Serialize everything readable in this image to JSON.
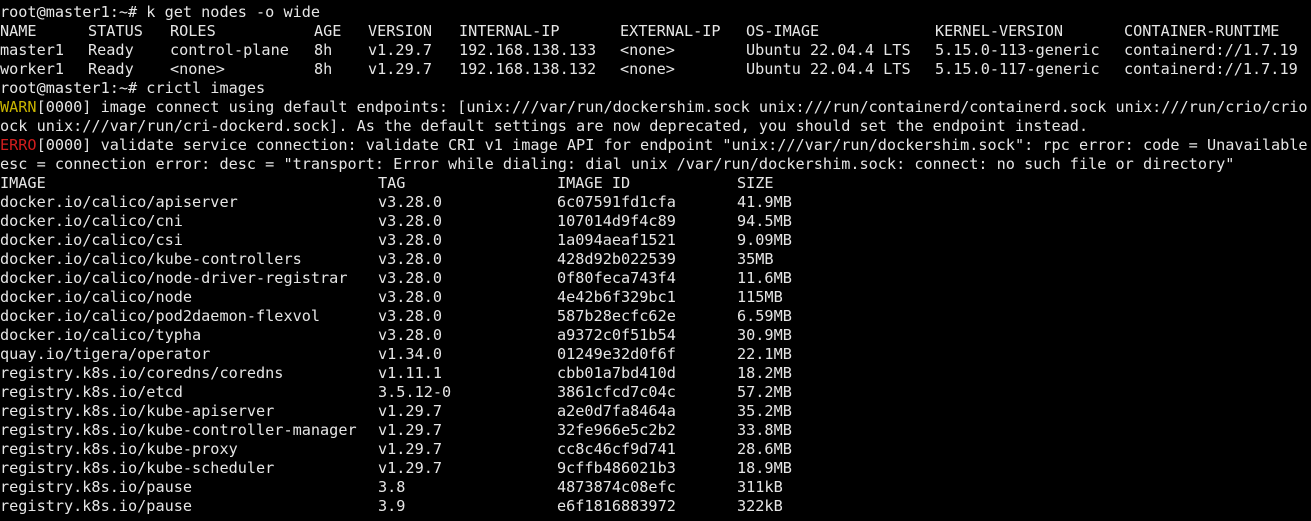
{
  "terminal": {
    "background": "#000000",
    "foreground": "#e6e6e6",
    "warn_color": "#c8b400",
    "error_color": "#d21e1e",
    "commands": {
      "get_nodes": "root@master1:~# k get nodes -o wide",
      "crictl_images": "root@master1:~# crictl images"
    },
    "nodes": {
      "headers": [
        "NAME",
        "STATUS",
        "ROLES",
        "AGE",
        "VERSION",
        "INTERNAL-IP",
        "EXTERNAL-IP",
        "OS-IMAGE",
        "KERNEL-VERSION",
        "CONTAINER-RUNTIME"
      ],
      "rows": [
        [
          "master1",
          "Ready",
          "control-plane",
          "8h",
          "v1.29.7",
          "192.168.138.133",
          "<none>",
          "Ubuntu 22.04.4 LTS",
          "5.15.0-113-generic",
          "containerd://1.7.19"
        ],
        [
          "worker1",
          "Ready",
          "<none>",
          "8h",
          "v1.29.7",
          "192.168.138.132",
          "<none>",
          "Ubuntu 22.04.4 LTS",
          "5.15.0-117-generic",
          "containerd://1.7.19"
        ]
      ]
    },
    "warn": {
      "tag": "WARN",
      "line1": "[0000] image connect using default endpoints: [unix:///var/run/dockershim.sock unix:///run/containerd/containerd.sock unix:///run/crio/crio.s",
      "line2": "ock unix:///var/run/cri-dockerd.sock]. As the default settings are now deprecated, you should set the endpoint instead."
    },
    "error": {
      "tag": "ERRO",
      "line1": "[0000] validate service connection: validate CRI v1 image API for endpoint \"unix:///var/run/dockershim.sock\": rpc error: code = Unavailable d",
      "line2": "esc = connection error: desc = \"transport: Error while dialing: dial unix /var/run/dockershim.sock: connect: no such file or directory\""
    },
    "images": {
      "headers": [
        "IMAGE",
        "TAG",
        "IMAGE ID",
        "SIZE"
      ],
      "rows": [
        [
          "docker.io/calico/apiserver",
          "v3.28.0",
          "6c07591fd1cfa",
          "41.9MB"
        ],
        [
          "docker.io/calico/cni",
          "v3.28.0",
          "107014d9f4c89",
          "94.5MB"
        ],
        [
          "docker.io/calico/csi",
          "v3.28.0",
          "1a094aeaf1521",
          "9.09MB"
        ],
        [
          "docker.io/calico/kube-controllers",
          "v3.28.0",
          "428d92b022539",
          "35MB"
        ],
        [
          "docker.io/calico/node-driver-registrar",
          "v3.28.0",
          "0f80feca743f4",
          "11.6MB"
        ],
        [
          "docker.io/calico/node",
          "v3.28.0",
          "4e42b6f329bc1",
          "115MB"
        ],
        [
          "docker.io/calico/pod2daemon-flexvol",
          "v3.28.0",
          "587b28ecfc62e",
          "6.59MB"
        ],
        [
          "docker.io/calico/typha",
          "v3.28.0",
          "a9372c0f51b54",
          "30.9MB"
        ],
        [
          "quay.io/tigera/operator",
          "v1.34.0",
          "01249e32d0f6f",
          "22.1MB"
        ],
        [
          "registry.k8s.io/coredns/coredns",
          "v1.11.1",
          "cbb01a7bd410d",
          "18.2MB"
        ],
        [
          "registry.k8s.io/etcd",
          "3.5.12-0",
          "3861cfcd7c04c",
          "57.2MB"
        ],
        [
          "registry.k8s.io/kube-apiserver",
          "v1.29.7",
          "a2e0d7fa8464a",
          "35.2MB"
        ],
        [
          "registry.k8s.io/kube-controller-manager",
          "v1.29.7",
          "32fe966e5c2b2",
          "33.8MB"
        ],
        [
          "registry.k8s.io/kube-proxy",
          "v1.29.7",
          "cc8c46cf9d741",
          "28.6MB"
        ],
        [
          "registry.k8s.io/kube-scheduler",
          "v1.29.7",
          "9cffb486021b3",
          "18.9MB"
        ],
        [
          "registry.k8s.io/pause",
          "3.8",
          "4873874c08efc",
          "311kB"
        ],
        [
          "registry.k8s.io/pause",
          "3.9",
          "e6f1816883972",
          "322kB"
        ]
      ]
    }
  }
}
